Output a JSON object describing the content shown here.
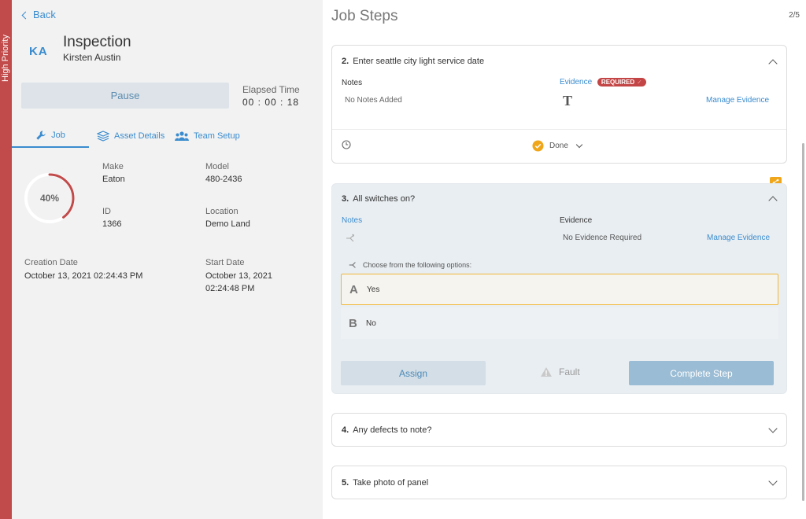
{
  "priority": {
    "label": "High Priority"
  },
  "left": {
    "back_label": "Back",
    "avatar_initials": "KA",
    "title": "Inspection",
    "subtitle": "Kirsten Austin",
    "pause_label": "Pause",
    "elapsed_label": "Elapsed Time",
    "elapsed_value": "00 : 00 : 18",
    "tabs": [
      {
        "label": "Job",
        "active": true
      },
      {
        "label": "Asset Details",
        "active": false
      },
      {
        "label": "Team Setup",
        "active": false
      }
    ],
    "progress": {
      "value": 40,
      "label": "40%"
    },
    "fields": {
      "make_label": "Make",
      "make_value": "Eaton",
      "model_label": "Model",
      "model_value": "480-2436",
      "id_label": "ID",
      "id_value": "1366",
      "location_label": "Location",
      "location_value": "Demo Land",
      "creation_label": "Creation Date",
      "creation_value": "October 13, 2021 02:24:43 PM",
      "start_label": "Start Date",
      "start_value_line1": "October 13, 2021",
      "start_value_line2": "02:24:48 PM"
    }
  },
  "right": {
    "title": "Job Steps",
    "pager": "2/5",
    "step2": {
      "number": "2.",
      "title": "Enter seattle city light service date",
      "notes_label": "Notes",
      "notes_value": "No Notes Added",
      "evidence_label": "Evidence",
      "required_badge": "REQUIRED",
      "manage_evidence": "Manage Evidence",
      "text_icon_glyph": "T",
      "status_label": "Done"
    },
    "step3": {
      "number": "3.",
      "title": "All switches on?",
      "notes_label": "Notes",
      "evidence_label": "Evidence",
      "evidence_value": "No Evidence Required",
      "manage_evidence": "Manage Evidence",
      "options_prompt": "Choose from the following options:",
      "options": [
        {
          "letter": "A",
          "label": "Yes",
          "selected": true
        },
        {
          "letter": "B",
          "label": "No",
          "selected": false
        }
      ],
      "assign_label": "Assign",
      "fault_label": "Fault",
      "complete_label": "Complete Step"
    },
    "step4": {
      "number": "4.",
      "title": "Any defects to note?"
    },
    "step5": {
      "number": "5.",
      "title": "Take photo of panel"
    }
  },
  "colors": {
    "priority": "#c14a4a",
    "accent": "#3a8ccf",
    "required": "#c34545",
    "done": "#f0a61a",
    "selected_border": "#f0b73a",
    "progress_arc": "#c14a4a"
  }
}
